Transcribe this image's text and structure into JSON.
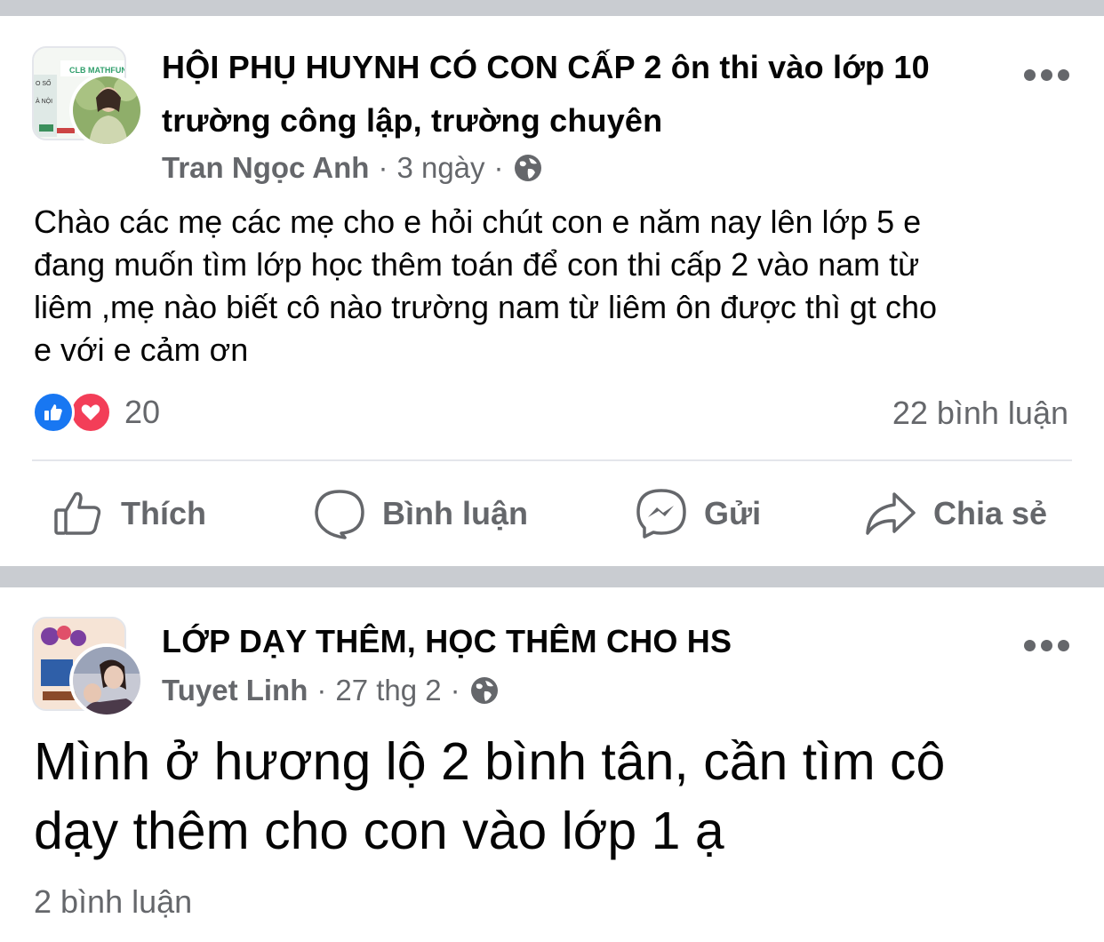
{
  "posts": [
    {
      "group_name_line1": "HỘI PHỤ HUYNH CÓ CON CẤP 2 ôn thi vào lớp 10",
      "group_name_line2": "trường công lập, trường chuyên",
      "group_thumb_text": "CLB MATHFUN",
      "author": "Tran Ngọc Anh",
      "time": "3 ngày",
      "privacy_icon": "globe-icon",
      "dot": "·",
      "text_lines": [
        "Chào các mẹ các mẹ cho e hỏi chút con e năm nay lên lớp 5 e",
        "đang muốn tìm lớp học thêm toán để con thi cấp 2 vào nam từ",
        "liêm ,mẹ nào biết cô nào trường nam từ liêm ôn được thì gt cho",
        "e với e cảm ơn"
      ],
      "reaction_count": "20",
      "comments": "22 bình luận"
    },
    {
      "group_name": "LỚP DẠY THÊM, HỌC THÊM CHO HS",
      "author": "Tuyet Linh",
      "time": "27 thg 2",
      "privacy_icon": "globe-icon",
      "dot": "·",
      "text_lines": [
        "Mình ở hương lộ 2 bình tân, cần tìm cô",
        "dạy thêm cho con vào lớp 1 ạ"
      ],
      "comments": "2 bình luận"
    }
  ],
  "actions": {
    "like": "Thích",
    "comment": "Bình luận",
    "send": "Gửi",
    "share": "Chia sẻ"
  },
  "colors": {
    "separator": "#c9ccd1",
    "secondary_text": "#65676b",
    "like_blue": "#1877f2",
    "love_red": "#f33e58"
  }
}
